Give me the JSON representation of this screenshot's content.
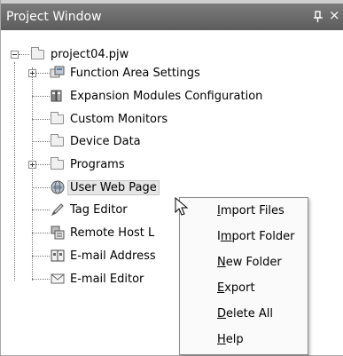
{
  "window": {
    "title": "Project Window",
    "pin_icon": "pin-icon",
    "close_glyph": "×"
  },
  "tree": {
    "root": {
      "label": "project04.pjw",
      "icon": "project-folder-icon",
      "expanded": true
    },
    "items": [
      {
        "label": "Function Area Settings",
        "icon": "function-area-icon",
        "expander": "plus"
      },
      {
        "label": "Expansion Modules Configuration",
        "icon": "module-icon",
        "expander": "none"
      },
      {
        "label": "Custom Monitors",
        "icon": "folder-icon",
        "expander": "none"
      },
      {
        "label": "Device Data",
        "icon": "folder-icon",
        "expander": "none"
      },
      {
        "label": "Programs",
        "icon": "folder-icon",
        "expander": "plus"
      },
      {
        "label": "User Web Page",
        "icon": "globe-icon",
        "expander": "none",
        "selected": true
      },
      {
        "label": "Tag Editor",
        "icon": "tag-pencil-icon",
        "expander": "none"
      },
      {
        "label": "Remote Host L",
        "icon": "remote-host-icon",
        "expander": "none"
      },
      {
        "label": "E-mail Address",
        "icon": "address-book-icon",
        "expander": "none"
      },
      {
        "label": "E-mail Editor",
        "icon": "envelope-icon",
        "expander": "none"
      }
    ]
  },
  "context_menu": {
    "items": [
      {
        "prefix": "",
        "mnemonic": "I",
        "rest": "mport Files"
      },
      {
        "prefix": "I",
        "mnemonic": "m",
        "rest": "port Folder"
      },
      {
        "prefix": "",
        "mnemonic": "N",
        "rest": "ew Folder"
      },
      {
        "prefix": "",
        "mnemonic": "E",
        "rest": "xport"
      },
      {
        "prefix": "",
        "mnemonic": "D",
        "rest": "elete All"
      },
      {
        "prefix": "",
        "mnemonic": "H",
        "rest": "elp"
      }
    ]
  },
  "colors": {
    "titlebar": "#6a6a6a",
    "selection": "#e6e6e6",
    "menu_background": "#fafafa"
  }
}
